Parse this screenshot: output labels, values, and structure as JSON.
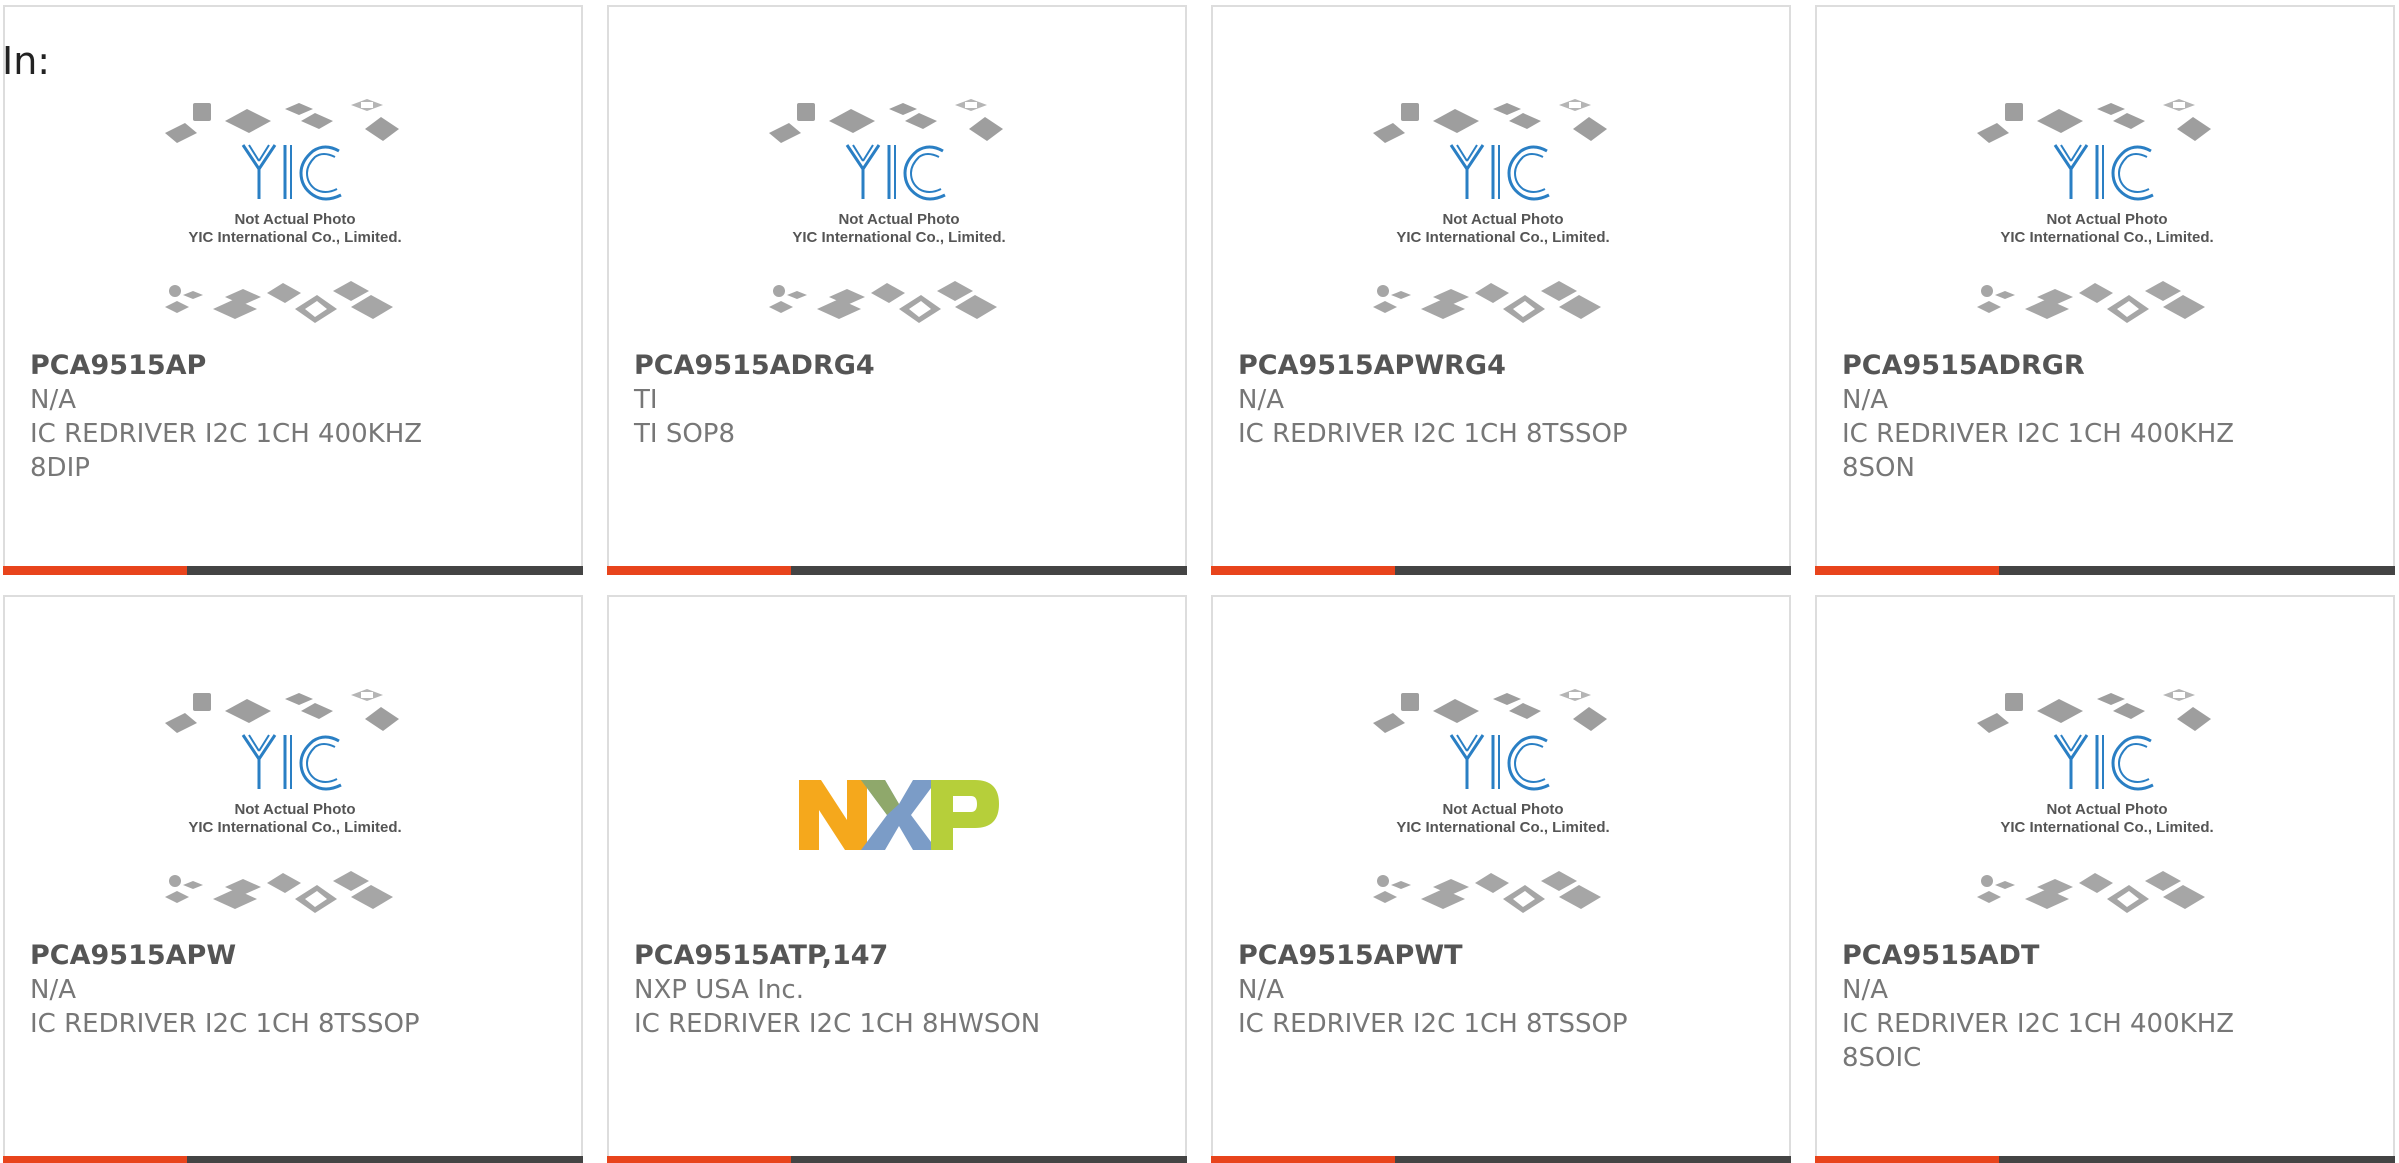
{
  "header": {
    "label": "In:"
  },
  "accent_color": "#e8441c",
  "bar_color": "#444444",
  "placeholder": {
    "line1": "Not Actual Photo",
    "line2": "YIC International Co., Limited.",
    "logo_text": "YIC"
  },
  "cards": [
    {
      "part": "PCA9515AP",
      "maker": "N/A",
      "desc": "IC REDRIVER I2C 1CH 400KHZ 8DIP",
      "image": "yic-placeholder"
    },
    {
      "part": "PCA9515ADRG4",
      "maker": "TI",
      "desc": "TI SOP8",
      "image": "yic-placeholder"
    },
    {
      "part": "PCA9515APWRG4",
      "maker": "N/A",
      "desc": "IC REDRIVER I2C 1CH 8TSSOP",
      "image": "yic-placeholder"
    },
    {
      "part": "PCA9515ADRGR",
      "maker": "N/A",
      "desc": "IC REDRIVER I2C 1CH 400KHZ 8SON",
      "image": "yic-placeholder"
    },
    {
      "part": "PCA9515APW",
      "maker": "N/A",
      "desc": "IC REDRIVER I2C 1CH 8TSSOP",
      "image": "yic-placeholder"
    },
    {
      "part": "PCA9515ATP,147",
      "maker": "NXP USA Inc.",
      "desc": "IC REDRIVER I2C 1CH 8HWSON",
      "image": "nxp-logo"
    },
    {
      "part": "PCA9515APWT",
      "maker": "N/A",
      "desc": "IC REDRIVER I2C 1CH 8TSSOP",
      "image": "yic-placeholder"
    },
    {
      "part": "PCA9515ADT",
      "maker": "N/A",
      "desc": "IC REDRIVER I2C 1CH 400KHZ 8SOIC",
      "image": "yic-placeholder"
    }
  ]
}
